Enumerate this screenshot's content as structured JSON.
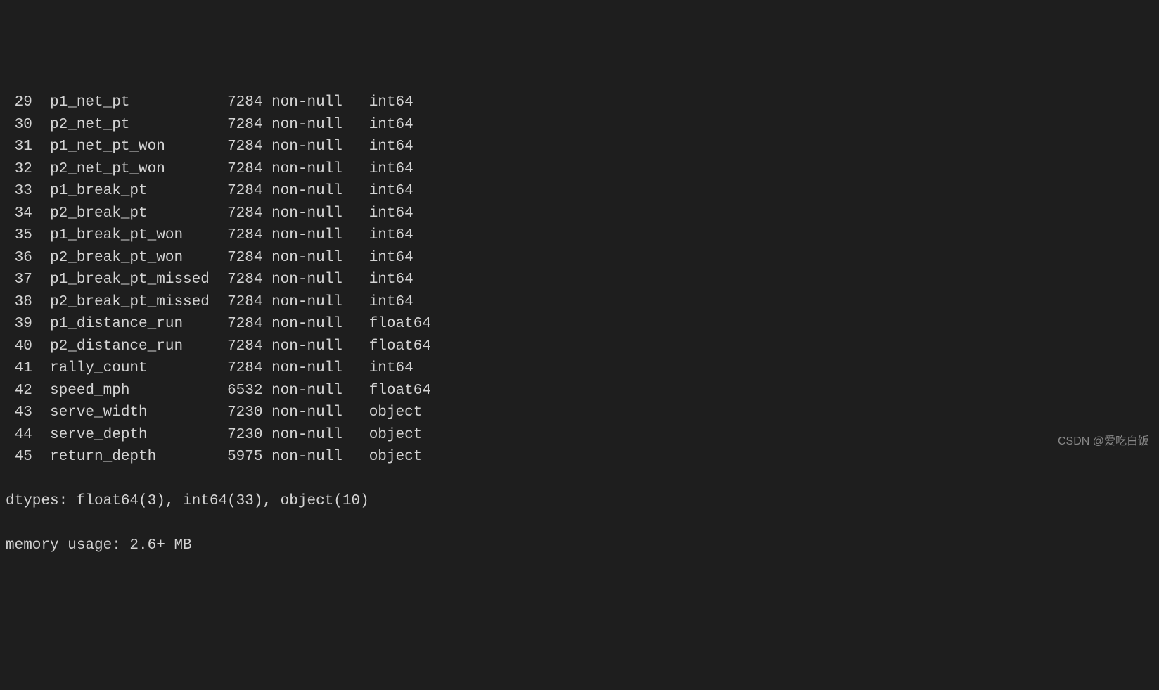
{
  "rows": [
    {
      "idx": "29",
      "name": "p1_net_pt",
      "count": "7284",
      "nonnull": "non-null",
      "dtype": "int64"
    },
    {
      "idx": "30",
      "name": "p2_net_pt",
      "count": "7284",
      "nonnull": "non-null",
      "dtype": "int64"
    },
    {
      "idx": "31",
      "name": "p1_net_pt_won",
      "count": "7284",
      "nonnull": "non-null",
      "dtype": "int64"
    },
    {
      "idx": "32",
      "name": "p2_net_pt_won",
      "count": "7284",
      "nonnull": "non-null",
      "dtype": "int64"
    },
    {
      "idx": "33",
      "name": "p1_break_pt",
      "count": "7284",
      "nonnull": "non-null",
      "dtype": "int64"
    },
    {
      "idx": "34",
      "name": "p2_break_pt",
      "count": "7284",
      "nonnull": "non-null",
      "dtype": "int64"
    },
    {
      "idx": "35",
      "name": "p1_break_pt_won",
      "count": "7284",
      "nonnull": "non-null",
      "dtype": "int64"
    },
    {
      "idx": "36",
      "name": "p2_break_pt_won",
      "count": "7284",
      "nonnull": "non-null",
      "dtype": "int64"
    },
    {
      "idx": "37",
      "name": "p1_break_pt_missed",
      "count": "7284",
      "nonnull": "non-null",
      "dtype": "int64"
    },
    {
      "idx": "38",
      "name": "p2_break_pt_missed",
      "count": "7284",
      "nonnull": "non-null",
      "dtype": "int64"
    },
    {
      "idx": "39",
      "name": "p1_distance_run",
      "count": "7284",
      "nonnull": "non-null",
      "dtype": "float64"
    },
    {
      "idx": "40",
      "name": "p2_distance_run",
      "count": "7284",
      "nonnull": "non-null",
      "dtype": "float64"
    },
    {
      "idx": "41",
      "name": "rally_count",
      "count": "7284",
      "nonnull": "non-null",
      "dtype": "int64"
    },
    {
      "idx": "42",
      "name": "speed_mph",
      "count": "6532",
      "nonnull": "non-null",
      "dtype": "float64"
    },
    {
      "idx": "43",
      "name": "serve_width",
      "count": "7230",
      "nonnull": "non-null",
      "dtype": "object"
    },
    {
      "idx": "44",
      "name": "serve_depth",
      "count": "7230",
      "nonnull": "non-null",
      "dtype": "object"
    },
    {
      "idx": "45",
      "name": "return_depth",
      "count": "5975",
      "nonnull": "non-null",
      "dtype": "object"
    }
  ],
  "dtypes_summary": "dtypes: float64(3), int64(33), object(10)",
  "memory_usage": "memory usage: 2.6+ MB",
  "watermark": "CSDN @爱吃白饭"
}
